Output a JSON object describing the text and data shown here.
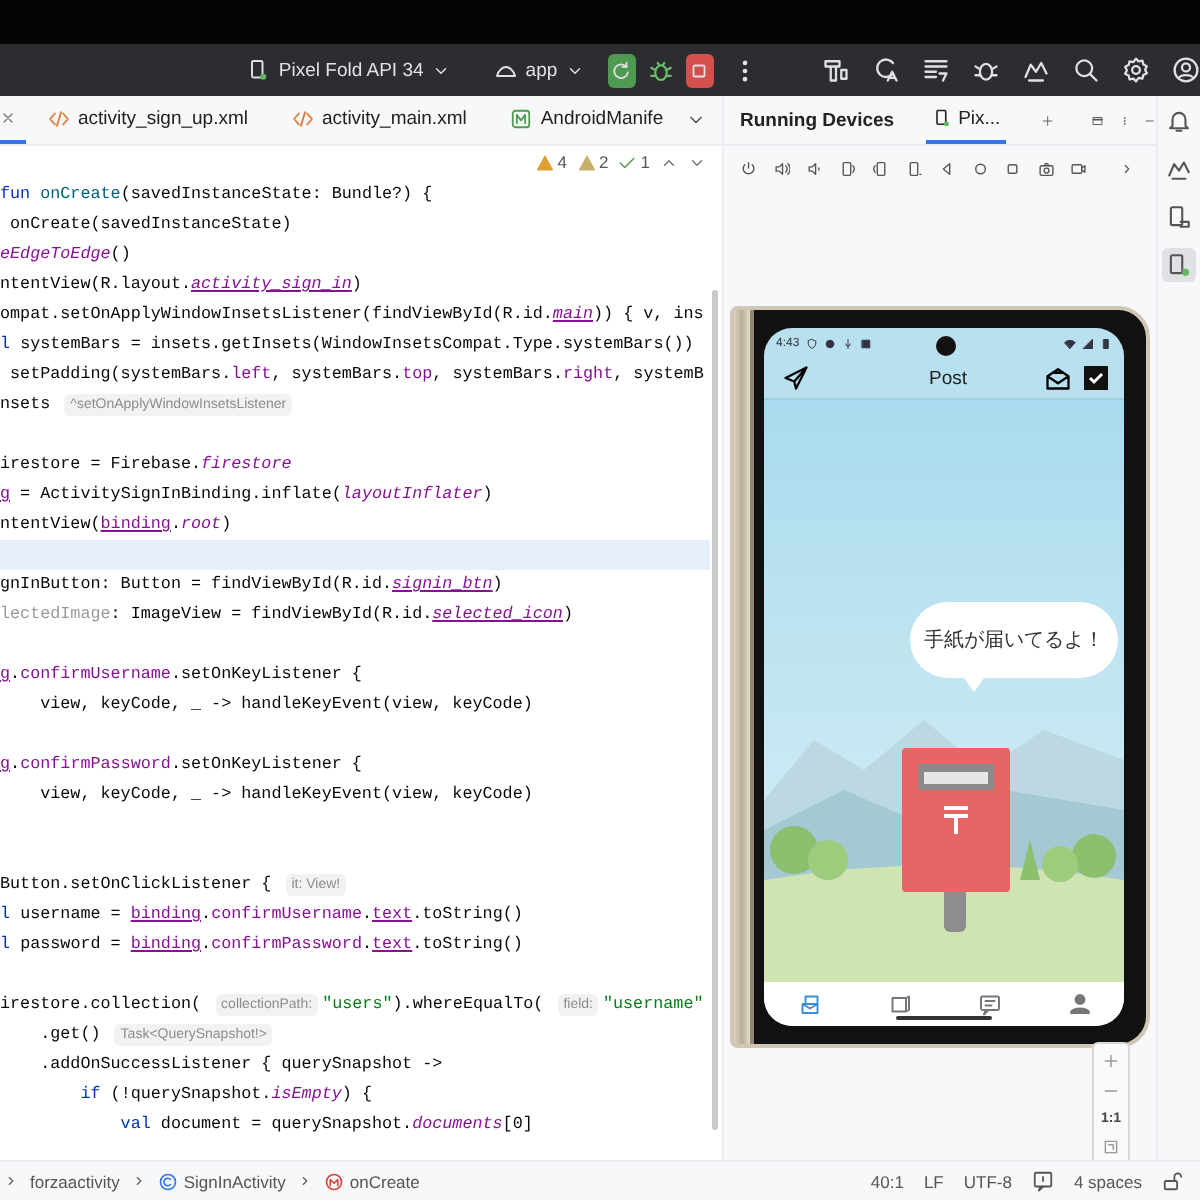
{
  "toolbar": {
    "device": "Pixel Fold API 34",
    "config": "app"
  },
  "editor_tabs": [
    {
      "kind": "cut",
      "selected": true
    },
    {
      "kind": "xml",
      "label": "activity_sign_up.xml",
      "selected": false
    },
    {
      "kind": "xml",
      "label": "activity_main.xml",
      "selected": false
    },
    {
      "kind": "manifest",
      "label": "AndroidManife",
      "selected": false
    }
  ],
  "inspections": [
    {
      "kind": "warning",
      "count": "4"
    },
    {
      "kind": "weak",
      "count": "2"
    },
    {
      "kind": "ok",
      "count": "1"
    }
  ],
  "code_lines": [
    {
      "current": false,
      "segments": [
        {
          "kind": "kw",
          "text": "fun "
        },
        {
          "kind": "fn",
          "text": "onCreate"
        },
        {
          "kind": "plain",
          "text": "(savedInstanceState: Bundle?) {"
        }
      ]
    },
    {
      "current": false,
      "segments": [
        {
          "kind": "plain",
          "text": " onCreate(savedInstanceState)"
        }
      ]
    },
    {
      "current": false,
      "segments": [
        {
          "kind": "ital",
          "text": "eEdgeToEdge"
        },
        {
          "kind": "plain",
          "text": "()"
        }
      ]
    },
    {
      "current": false,
      "segments": [
        {
          "kind": "plain",
          "text": "ntentView(R.layout."
        },
        {
          "kind": "link",
          "text": "activity_sign_in"
        },
        {
          "kind": "plain",
          "text": ")"
        }
      ]
    },
    {
      "current": false,
      "segments": [
        {
          "kind": "plain",
          "text": "ompat.setOnApplyWindowInsetsListener(findViewById(R.id."
        },
        {
          "kind": "link",
          "text": "main"
        },
        {
          "kind": "plain",
          "text": ")) { v, ins"
        }
      ]
    },
    {
      "current": false,
      "segments": [
        {
          "kind": "kw",
          "text": "l "
        },
        {
          "kind": "plain",
          "text": "systemBars = insets.getInsets(WindowInsetsCompat.Type.systemBars())"
        }
      ]
    },
    {
      "current": false,
      "segments": [
        {
          "kind": "plain",
          "text": " setPadding(systemBars."
        },
        {
          "kind": "member",
          "text": "left"
        },
        {
          "kind": "plain",
          "text": ", systemBars."
        },
        {
          "kind": "member",
          "text": "top"
        },
        {
          "kind": "plain",
          "text": ", systemBars."
        },
        {
          "kind": "member",
          "text": "right"
        },
        {
          "kind": "plain",
          "text": ", systemB"
        }
      ]
    },
    {
      "current": false,
      "segments": [
        {
          "kind": "plain",
          "text": "nsets "
        },
        {
          "kind": "hint",
          "text": "^setOnApplyWindowInsetsListener"
        }
      ]
    },
    {
      "current": false
    },
    {
      "current": false,
      "segments": [
        {
          "kind": "plain",
          "text": "irestore = Firebase."
        },
        {
          "kind": "ital",
          "text": "firestore"
        }
      ]
    },
    {
      "current": false,
      "segments": [
        {
          "kind": "under",
          "text": "g"
        },
        {
          "kind": "plain",
          "text": " = ActivitySignInBinding.inflate("
        },
        {
          "kind": "ital",
          "text": "layoutInflater"
        },
        {
          "kind": "plain",
          "text": ")"
        }
      ]
    },
    {
      "current": false,
      "segments": [
        {
          "kind": "plain",
          "text": "ntentView("
        },
        {
          "kind": "under",
          "text": "binding"
        },
        {
          "kind": "plain",
          "text": "."
        },
        {
          "kind": "ital",
          "text": "root"
        },
        {
          "kind": "plain",
          "text": ")"
        }
      ]
    },
    {
      "current": true
    },
    {
      "current": false,
      "segments": [
        {
          "kind": "plain",
          "text": "gnInButton: Button = findViewById(R.id."
        },
        {
          "kind": "link",
          "text": "signin_btn"
        },
        {
          "kind": "plain",
          "text": ")"
        }
      ]
    },
    {
      "current": false,
      "segments": [
        {
          "kind": "grey",
          "text": "lectedImage"
        },
        {
          "kind": "plain",
          "text": ": ImageView = findViewById(R.id."
        },
        {
          "kind": "link",
          "text": "selected_icon"
        },
        {
          "kind": "plain",
          "text": ")"
        }
      ]
    },
    {
      "current": false
    },
    {
      "current": false,
      "segments": [
        {
          "kind": "under",
          "text": "g"
        },
        {
          "kind": "plain",
          "text": "."
        },
        {
          "kind": "member",
          "text": "confirmUsername"
        },
        {
          "kind": "plain",
          "text": ".setOnKeyListener {"
        }
      ]
    },
    {
      "current": false,
      "segments": [
        {
          "kind": "plain",
          "text": "    view, keyCode, _ -> handleKeyEvent(view, keyCode)"
        }
      ]
    },
    {
      "current": false
    },
    {
      "current": false,
      "segments": [
        {
          "kind": "under",
          "text": "g"
        },
        {
          "kind": "plain",
          "text": "."
        },
        {
          "kind": "member",
          "text": "confirmPassword"
        },
        {
          "kind": "plain",
          "text": ".setOnKeyListener {"
        }
      ]
    },
    {
      "current": false,
      "segments": [
        {
          "kind": "plain",
          "text": "    view, keyCode, _ -> handleKeyEvent(view, keyCode)"
        }
      ]
    },
    {
      "current": false
    },
    {
      "current": false
    },
    {
      "current": false,
      "segments": [
        {
          "kind": "plain",
          "text": "Button.setOnClickListener { "
        },
        {
          "kind": "hint",
          "text": "it: View!"
        }
      ]
    },
    {
      "current": false,
      "segments": [
        {
          "kind": "kw",
          "text": "l "
        },
        {
          "kind": "plain",
          "text": "username = "
        },
        {
          "kind": "under",
          "text": "binding"
        },
        {
          "kind": "plain",
          "text": "."
        },
        {
          "kind": "member",
          "text": "confirmUsername"
        },
        {
          "kind": "plain",
          "text": "."
        },
        {
          "kind": "under",
          "text": "text"
        },
        {
          "kind": "plain",
          "text": ".toString()"
        }
      ]
    },
    {
      "current": false,
      "segments": [
        {
          "kind": "kw",
          "text": "l "
        },
        {
          "kind": "plain",
          "text": "password = "
        },
        {
          "kind": "under",
          "text": "binding"
        },
        {
          "kind": "plain",
          "text": "."
        },
        {
          "kind": "member",
          "text": "confirmPassword"
        },
        {
          "kind": "plain",
          "text": "."
        },
        {
          "kind": "under",
          "text": "text"
        },
        {
          "kind": "plain",
          "text": ".toString()"
        }
      ]
    },
    {
      "current": false
    },
    {
      "current": false,
      "segments": [
        {
          "kind": "plain",
          "text": "irestore.collection( "
        },
        {
          "kind": "hint",
          "text": "collectionPath:"
        },
        {
          "kind": "string",
          "text": "\"users\""
        },
        {
          "kind": "plain",
          "text": ").whereEqualTo( "
        },
        {
          "kind": "hint",
          "text": "field:"
        },
        {
          "kind": "string",
          "text": "\"username\""
        }
      ]
    },
    {
      "current": false,
      "segments": [
        {
          "kind": "plain",
          "text": "    .get() "
        },
        {
          "kind": "hint",
          "text": "Task<QuerySnapshot!>"
        }
      ]
    },
    {
      "current": false,
      "segments": [
        {
          "kind": "plain",
          "text": "    .addOnSuccessListener { querySnapshot ->"
        }
      ]
    },
    {
      "current": false,
      "segments": [
        {
          "kind": "kw",
          "text": "        if"
        },
        {
          "kind": "plain",
          "text": " (!querySnapshot."
        },
        {
          "kind": "ital",
          "text": "isEmpty"
        },
        {
          "kind": "plain",
          "text": ") {"
        }
      ]
    },
    {
      "current": false,
      "segments": [
        {
          "kind": "kw",
          "text": "            val"
        },
        {
          "kind": "plain",
          "text": " document = querySnapshot."
        },
        {
          "kind": "ital",
          "text": "documents"
        },
        {
          "kind": "plain",
          "text": "[0]"
        }
      ]
    }
  ],
  "device_panel": {
    "title": "Running Devices",
    "tab": "Pix...",
    "phone": {
      "time": "4:43",
      "app_title": "Post",
      "bubble": "手紙が届いてるよ！",
      "nav": [
        {
          "kind": "mail",
          "selected": true
        },
        {
          "kind": "book",
          "selected": false
        },
        {
          "kind": "chat",
          "selected": false
        },
        {
          "kind": "person",
          "selected": false
        }
      ]
    },
    "zoom_reset": "1:1"
  },
  "breadcrumb": [
    {
      "kind": "package",
      "label": "forzaactivity"
    },
    {
      "kind": "class",
      "label": "SignInActivity"
    },
    {
      "kind": "method",
      "label": "onCreate"
    }
  ],
  "status_items": [
    {
      "kind": "text",
      "label": "40:1"
    },
    {
      "kind": "text",
      "label": "LF"
    },
    {
      "kind": "text",
      "label": "UTF-8"
    },
    {
      "kind": "icon"
    },
    {
      "kind": "text",
      "label": "4 spaces"
    },
    {
      "kind": "lock"
    }
  ]
}
